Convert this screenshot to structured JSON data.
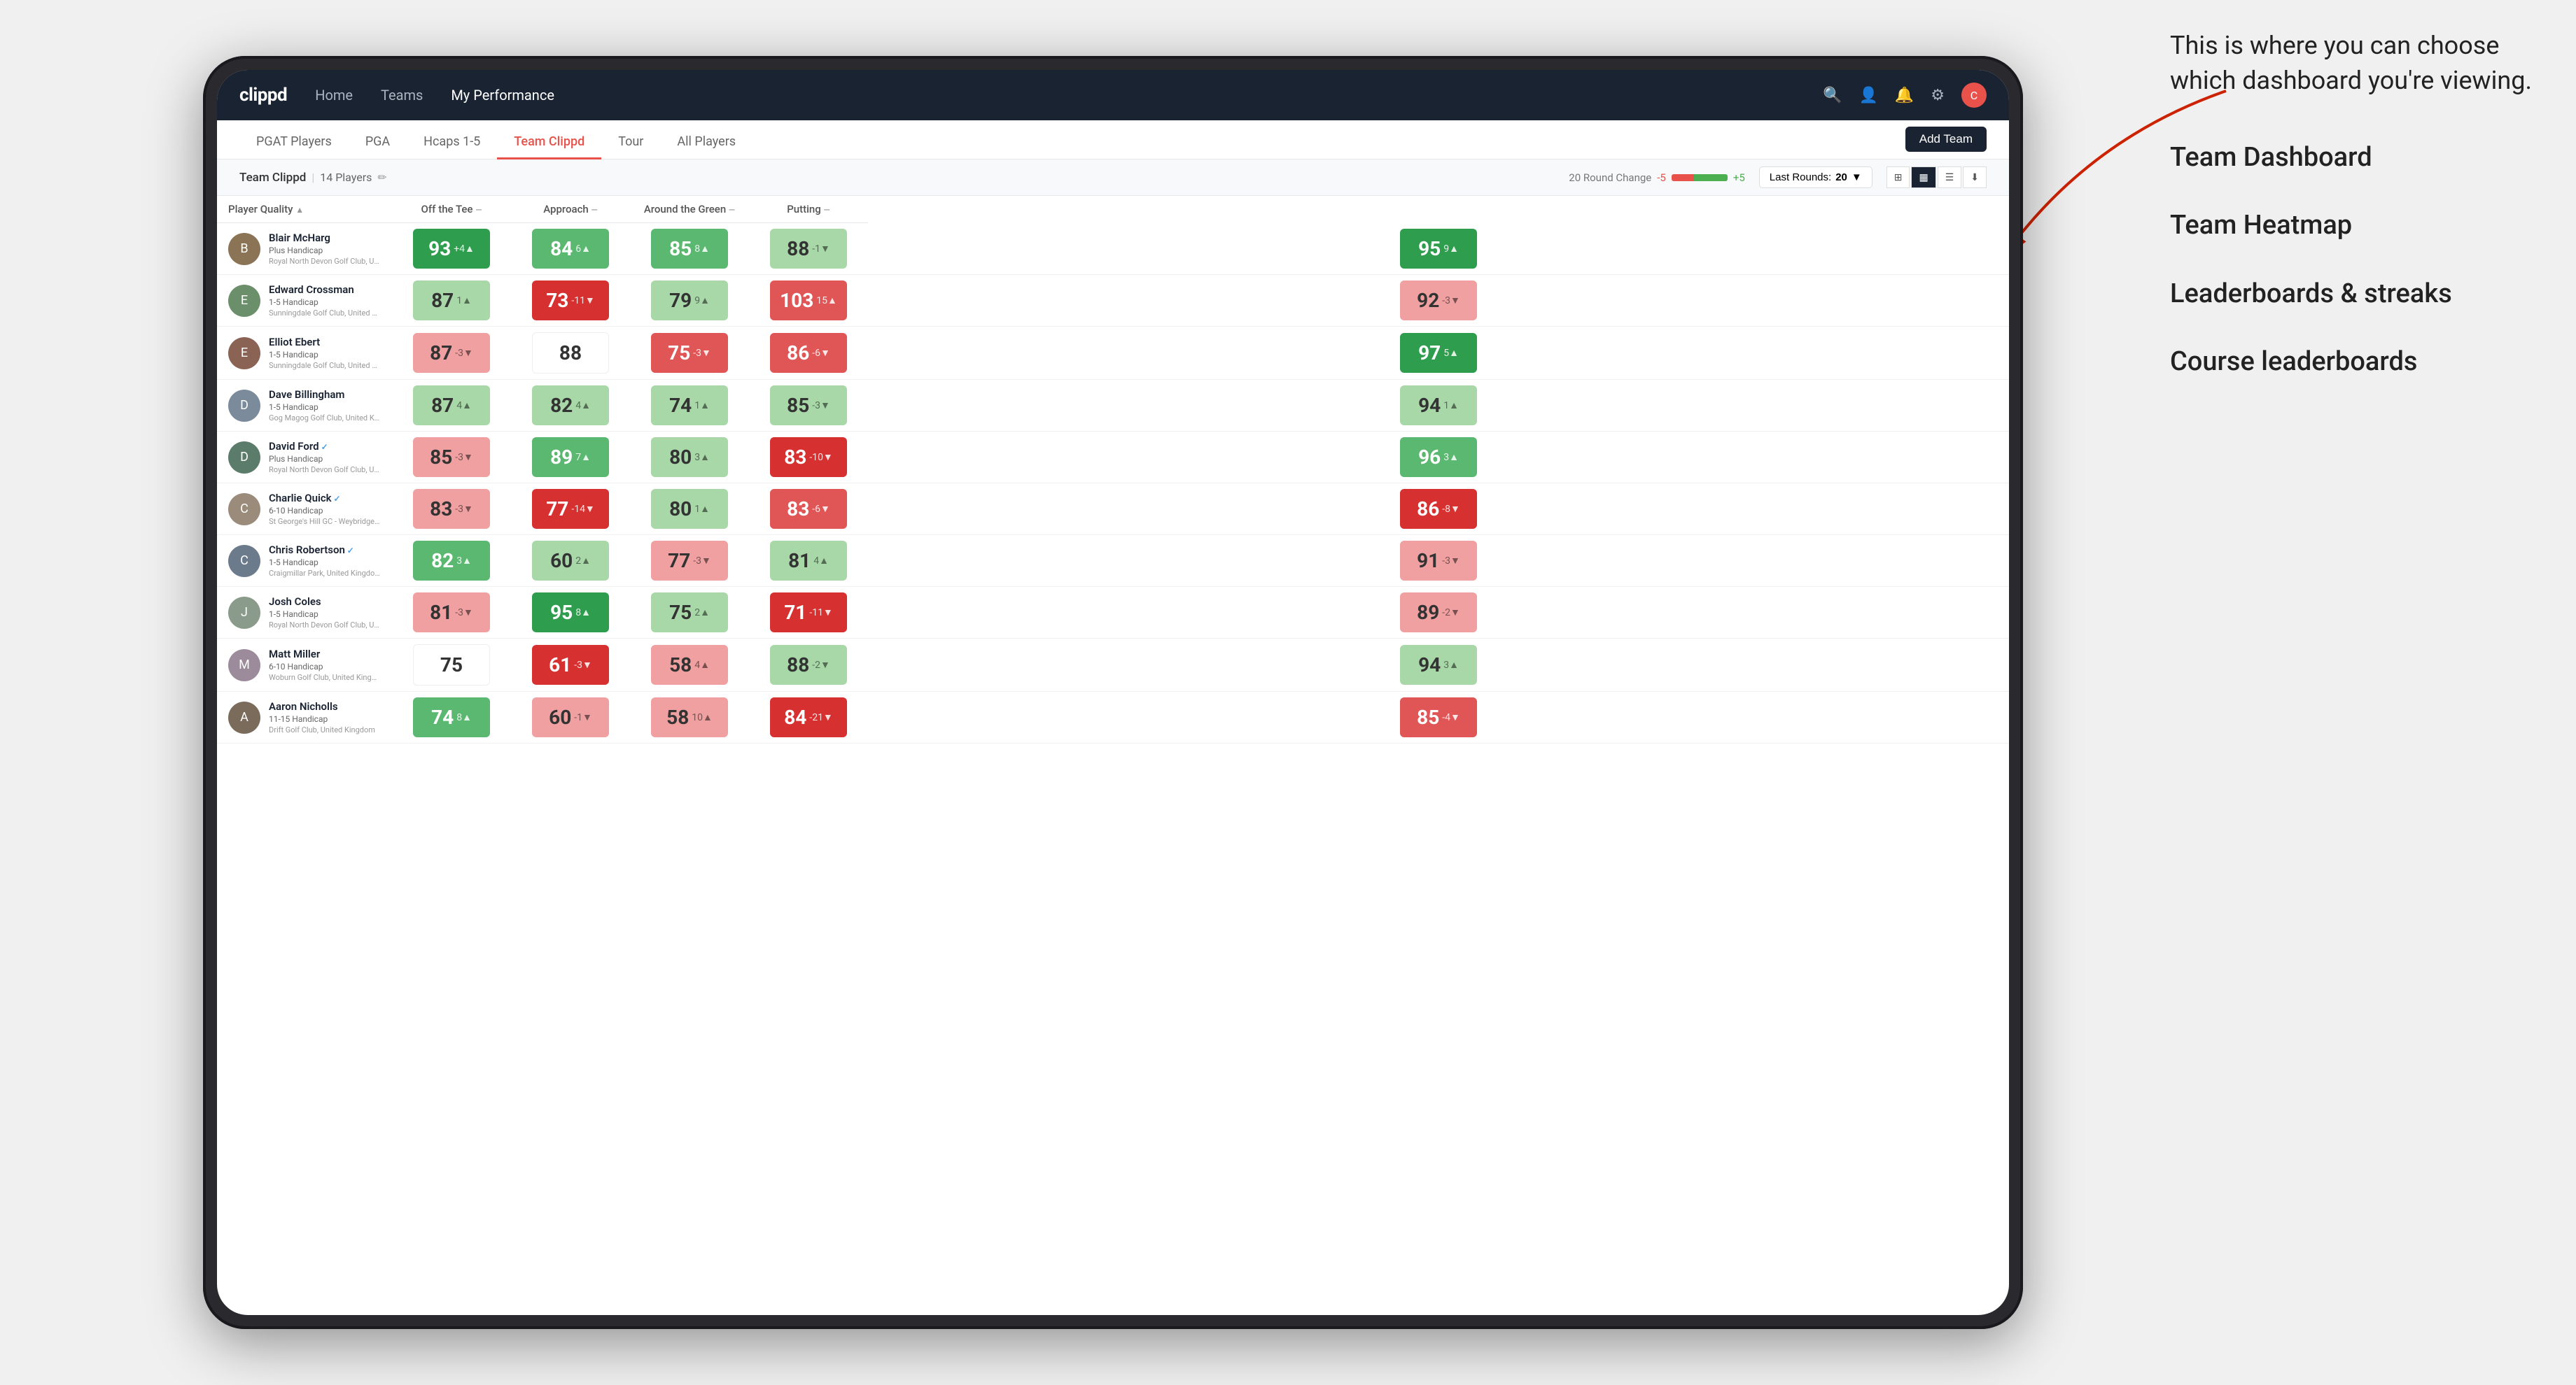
{
  "annotation": {
    "callout": "This is where you can choose which dashboard you're viewing.",
    "items": [
      "Team Dashboard",
      "Team Heatmap",
      "Leaderboards & streaks",
      "Course leaderboards"
    ]
  },
  "nav": {
    "logo": "clippd",
    "links": [
      "Home",
      "Teams",
      "My Performance"
    ],
    "active_link": "My Performance",
    "icons": [
      "search",
      "person",
      "bell",
      "settings",
      "avatar"
    ]
  },
  "tabs": {
    "items": [
      "PGAT Players",
      "PGA",
      "Hcaps 1-5",
      "Team Clippd",
      "Tour",
      "All Players"
    ],
    "active": "Team Clippd",
    "add_btn": "Add Team"
  },
  "sub_header": {
    "team_name": "Team Clippd",
    "separator": "|",
    "player_count": "14 Players",
    "round_change_label": "20 Round Change",
    "change_neg": "-5",
    "change_pos": "+5",
    "last_rounds_label": "Last Rounds:",
    "last_rounds_value": "20"
  },
  "table": {
    "columns": [
      {
        "label": "Player Quality",
        "sort": true
      },
      {
        "label": "Off the Tee",
        "sort": true
      },
      {
        "label": "Approach",
        "sort": true
      },
      {
        "label": "Around the Green",
        "sort": true
      },
      {
        "label": "Putting",
        "sort": true
      }
    ],
    "players": [
      {
        "name": "Blair McHarg",
        "handicap": "Plus Handicap",
        "club": "Royal North Devon Golf Club, United Kingdom",
        "avatar_color": "#8B7355",
        "scores": [
          {
            "value": 93,
            "change": "+4",
            "dir": "up",
            "bg": "green-strong"
          },
          {
            "value": 84,
            "change": "6",
            "dir": "up",
            "bg": "green-mid"
          },
          {
            "value": 85,
            "change": "8",
            "dir": "up",
            "bg": "green-mid"
          },
          {
            "value": 88,
            "change": "-1",
            "dir": "down",
            "bg": "green-light"
          },
          {
            "value": 95,
            "change": "9",
            "dir": "up",
            "bg": "green-strong"
          }
        ]
      },
      {
        "name": "Edward Crossman",
        "handicap": "1-5 Handicap",
        "club": "Sunningdale Golf Club, United Kingdom",
        "avatar_color": "#6B8E6B",
        "scores": [
          {
            "value": 87,
            "change": "1",
            "dir": "up",
            "bg": "green-light"
          },
          {
            "value": 73,
            "change": "-11",
            "dir": "down",
            "bg": "red-strong"
          },
          {
            "value": 79,
            "change": "9",
            "dir": "up",
            "bg": "green-light"
          },
          {
            "value": 103,
            "change": "15",
            "dir": "up",
            "bg": "red-mid"
          },
          {
            "value": 92,
            "change": "-3",
            "dir": "down",
            "bg": "red-light"
          }
        ]
      },
      {
        "name": "Elliot Ebert",
        "handicap": "1-5 Handicap",
        "club": "Sunningdale Golf Club, United Kingdom",
        "avatar_color": "#8B6355",
        "scores": [
          {
            "value": 87,
            "change": "-3",
            "dir": "down",
            "bg": "red-light"
          },
          {
            "value": 88,
            "change": "",
            "dir": "",
            "bg": "white"
          },
          {
            "value": 75,
            "change": "-3",
            "dir": "down",
            "bg": "red-mid"
          },
          {
            "value": 86,
            "change": "-6",
            "dir": "down",
            "bg": "red-mid"
          },
          {
            "value": 97,
            "change": "5",
            "dir": "up",
            "bg": "green-strong"
          }
        ]
      },
      {
        "name": "Dave Billingham",
        "handicap": "1-5 Handicap",
        "club": "Gog Magog Golf Club, United Kingdom",
        "avatar_color": "#7B8B9B",
        "scores": [
          {
            "value": 87,
            "change": "4",
            "dir": "up",
            "bg": "green-light"
          },
          {
            "value": 82,
            "change": "4",
            "dir": "up",
            "bg": "green-light"
          },
          {
            "value": 74,
            "change": "1",
            "dir": "up",
            "bg": "green-light"
          },
          {
            "value": 85,
            "change": "-3",
            "dir": "down",
            "bg": "green-light"
          },
          {
            "value": 94,
            "change": "1",
            "dir": "up",
            "bg": "green-light"
          }
        ]
      },
      {
        "name": "David Ford",
        "handicap": "Plus Handicap",
        "club": "Royal North Devon Golf Club, United Kingdom",
        "avatar_color": "#5B7B6B",
        "verified": true,
        "scores": [
          {
            "value": 85,
            "change": "-3",
            "dir": "down",
            "bg": "red-light"
          },
          {
            "value": 89,
            "change": "7",
            "dir": "up",
            "bg": "green-mid"
          },
          {
            "value": 80,
            "change": "3",
            "dir": "up",
            "bg": "green-light"
          },
          {
            "value": 83,
            "change": "-10",
            "dir": "down",
            "bg": "red-strong"
          },
          {
            "value": 96,
            "change": "3",
            "dir": "up",
            "bg": "green-mid"
          }
        ]
      },
      {
        "name": "Charlie Quick",
        "handicap": "6-10 Handicap",
        "club": "St George's Hill GC - Weybridge - Surrey, Uni...",
        "avatar_color": "#9B8B7B",
        "verified": true,
        "scores": [
          {
            "value": 83,
            "change": "-3",
            "dir": "down",
            "bg": "red-light"
          },
          {
            "value": 77,
            "change": "-14",
            "dir": "down",
            "bg": "red-strong"
          },
          {
            "value": 80,
            "change": "1",
            "dir": "up",
            "bg": "green-light"
          },
          {
            "value": 83,
            "change": "-6",
            "dir": "down",
            "bg": "red-mid"
          },
          {
            "value": 86,
            "change": "-8",
            "dir": "down",
            "bg": "red-strong"
          }
        ]
      },
      {
        "name": "Chris Robertson",
        "handicap": "1-5 Handicap",
        "club": "Craigmillar Park, United Kingdom",
        "avatar_color": "#6B7B8B",
        "verified": true,
        "scores": [
          {
            "value": 82,
            "change": "3",
            "dir": "up",
            "bg": "green-mid"
          },
          {
            "value": 60,
            "change": "2",
            "dir": "up",
            "bg": "green-light"
          },
          {
            "value": 77,
            "change": "-3",
            "dir": "down",
            "bg": "red-light"
          },
          {
            "value": 81,
            "change": "4",
            "dir": "up",
            "bg": "green-light"
          },
          {
            "value": 91,
            "change": "-3",
            "dir": "down",
            "bg": "red-light"
          }
        ]
      },
      {
        "name": "Josh Coles",
        "handicap": "1-5 Handicap",
        "club": "Royal North Devon Golf Club, United Kingdom",
        "avatar_color": "#8B9B8B",
        "scores": [
          {
            "value": 81,
            "change": "-3",
            "dir": "down",
            "bg": "red-light"
          },
          {
            "value": 95,
            "change": "8",
            "dir": "up",
            "bg": "green-strong"
          },
          {
            "value": 75,
            "change": "2",
            "dir": "up",
            "bg": "green-light"
          },
          {
            "value": 71,
            "change": "-11",
            "dir": "down",
            "bg": "red-strong"
          },
          {
            "value": 89,
            "change": "-2",
            "dir": "down",
            "bg": "red-light"
          }
        ]
      },
      {
        "name": "Matt Miller",
        "handicap": "6-10 Handicap",
        "club": "Woburn Golf Club, United Kingdom",
        "avatar_color": "#9B8B9B",
        "scores": [
          {
            "value": 75,
            "change": "",
            "dir": "",
            "bg": "white"
          },
          {
            "value": 61,
            "change": "-3",
            "dir": "down",
            "bg": "red-strong"
          },
          {
            "value": 58,
            "change": "4",
            "dir": "up",
            "bg": "red-light"
          },
          {
            "value": 88,
            "change": "-2",
            "dir": "down",
            "bg": "green-light"
          },
          {
            "value": 94,
            "change": "3",
            "dir": "up",
            "bg": "green-light"
          }
        ]
      },
      {
        "name": "Aaron Nicholls",
        "handicap": "11-15 Handicap",
        "club": "Drift Golf Club, United Kingdom",
        "avatar_color": "#7B6B5B",
        "scores": [
          {
            "value": 74,
            "change": "8",
            "dir": "up",
            "bg": "green-mid"
          },
          {
            "value": 60,
            "change": "-1",
            "dir": "down",
            "bg": "red-light"
          },
          {
            "value": 58,
            "change": "10",
            "dir": "up",
            "bg": "red-light"
          },
          {
            "value": 84,
            "change": "-21",
            "dir": "down",
            "bg": "red-strong"
          },
          {
            "value": 85,
            "change": "-4",
            "dir": "down",
            "bg": "red-mid"
          }
        ]
      }
    ]
  }
}
